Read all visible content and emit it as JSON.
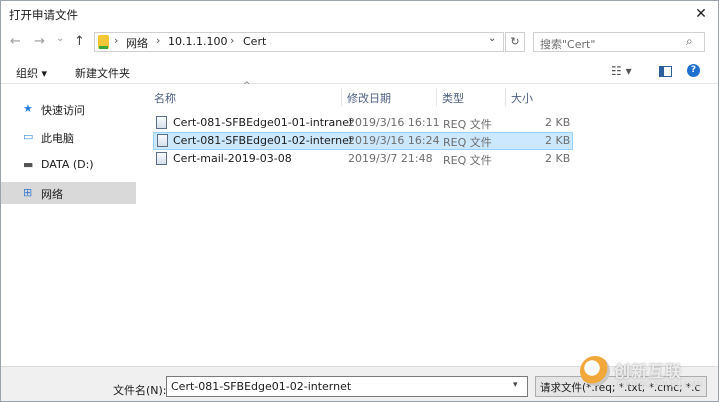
{
  "window": {
    "title": "打开申请文件",
    "close_glyph": "✕"
  },
  "nav": {
    "back_glyph": "←",
    "forward_glyph": "→",
    "recent_glyph": "⌄",
    "up_glyph": "↑",
    "breadcrumb": [
      "网络",
      "10.1.1.100",
      "Cert"
    ],
    "separator": "›",
    "dropdown_glyph": "⌄",
    "refresh_glyph": "↻",
    "search_placeholder": "搜索\"Cert\"",
    "search_icon_glyph": "⌕"
  },
  "toolbar": {
    "organize_label": "组织 ▾",
    "new_folder_label": "新建文件夹",
    "view_glyph": "☷ ▾",
    "preview_glyph": "▯",
    "help_glyph": "?"
  },
  "sidebar": {
    "items": [
      {
        "label": "快速访问",
        "icon_glyph": "★",
        "icon": "star-icon",
        "color": "#2f7fd8"
      },
      {
        "label": "此电脑",
        "icon_glyph": "▭",
        "icon": "computer-icon",
        "color": "#3a8fd8"
      },
      {
        "label": "DATA (D:)",
        "icon_glyph": "▬",
        "icon": "drive-icon",
        "color": "#555555"
      },
      {
        "label": "网络",
        "icon_glyph": "⊞",
        "icon": "network-icon",
        "color": "#3a7fd0"
      }
    ],
    "selected_index": 3
  },
  "columns": {
    "name": "名称",
    "modified": "修改日期",
    "type": "类型",
    "size": "大小",
    "sort_glyph": "^"
  },
  "files": [
    {
      "name": "Cert-081-SFBEdge01-01-intranet",
      "modified": "2019/3/16 16:11",
      "type": "REQ 文件",
      "size": "2 KB"
    },
    {
      "name": "Cert-081-SFBEdge01-02-internet",
      "modified": "2019/3/16 16:24",
      "type": "REQ 文件",
      "size": "2 KB"
    },
    {
      "name": "Cert-mail-2019-03-08",
      "modified": "2019/3/7 21:48",
      "type": "REQ 文件",
      "size": "2 KB"
    }
  ],
  "selected_file_index": 1,
  "footer": {
    "filename_label": "文件名(N):",
    "filename_value": "Cert-081-SFBEdge01-02-internet",
    "filename_dropdown_glyph": "▾",
    "filter_value": "请求文件(*.req; *.txt; *.cmc; *.c"
  },
  "watermark": {
    "text": "创新互联",
    "subtext": "CHUANG XIN HU LIAN"
  },
  "colors": {
    "selected_row": "#cce8ff",
    "selected_row_border": "#99d1ff",
    "sidebar_selected": "#d9d9d9",
    "header_text": "#4d6082"
  }
}
